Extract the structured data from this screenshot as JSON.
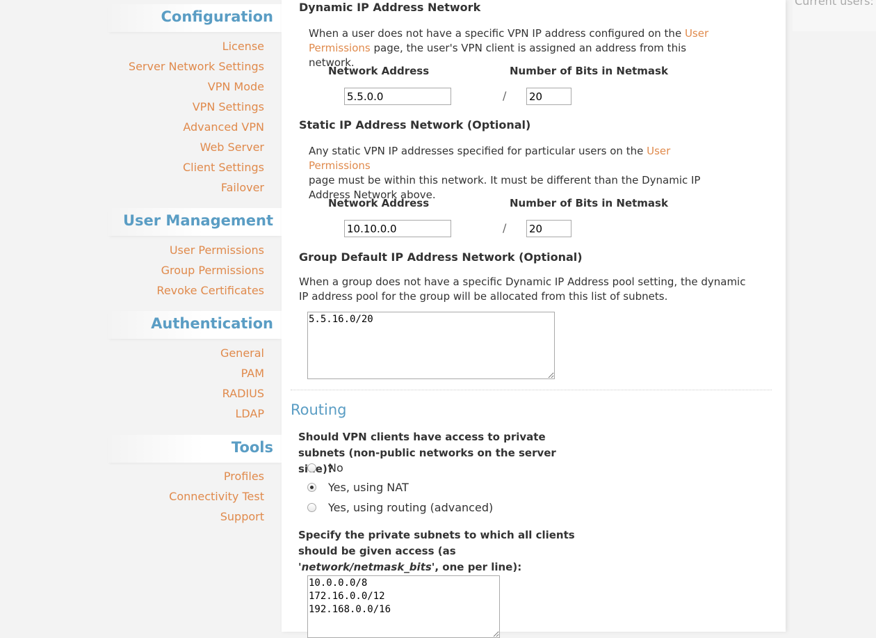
{
  "sidebar": {
    "sections": [
      {
        "title": "Configuration",
        "items": [
          "License",
          "Server Network Settings",
          "VPN Mode",
          "VPN Settings",
          "Advanced VPN",
          "Web Server",
          "Client Settings",
          "Failover"
        ]
      },
      {
        "title": "User Management",
        "items": [
          "User Permissions",
          "Group Permissions",
          "Revoke Certificates"
        ]
      },
      {
        "title": "Authentication",
        "items": [
          "General",
          "PAM",
          "RADIUS",
          "LDAP"
        ]
      },
      {
        "title": "Tools",
        "items": [
          "Profiles",
          "Connectivity Test",
          "Support"
        ]
      }
    ]
  },
  "header_right": {
    "text": "Current users:"
  },
  "dynamic": {
    "heading": "Dynamic IP Address Network",
    "desc_pre": "When a user does not have a specific VPN IP address configured on the ",
    "desc_link": "User Permissions",
    "desc_post": " page, the user's VPN client is assigned an address from this network.",
    "network_label": "Network Address",
    "bits_label": "Number of Bits in Netmask",
    "network_value": "5.5.0.0",
    "bits_value": "20",
    "slash": "/"
  },
  "static": {
    "heading": "Static IP Address Network (Optional)",
    "desc_pre": "Any static VPN IP addresses specified for particular users on the ",
    "desc_link": "User Permissions",
    "desc_post": " page must be within this network. It must be different than the Dynamic IP Address Network above.",
    "network_label": "Network Address",
    "bits_label": "Number of Bits in Netmask",
    "network_value": "10.10.0.0",
    "bits_value": "20",
    "slash": "/"
  },
  "group": {
    "heading": "Group Default IP Address Network (Optional)",
    "desc": "When a group does not have a specific Dynamic IP Address pool setting, the dynamic IP address pool for the group will be allocated from this list of subnets.",
    "textarea_value": "5.5.16.0/20"
  },
  "routing": {
    "title": "Routing",
    "question": "Should VPN clients have access to private subnets (non-public networks on the server side)?",
    "options": [
      {
        "label": "No",
        "checked": false
      },
      {
        "label": "Yes, using NAT",
        "checked": true
      },
      {
        "label": "Yes, using routing (advanced)",
        "checked": false
      }
    ],
    "subnets_pre": "Specify the private subnets to which all clients should be given access (as '",
    "subnets_em": "network/netmask_bits",
    "subnets_post": "', one per line):",
    "subnets_value": "10.0.0.0/8\n172.16.0.0/12\n192.168.0.0/16"
  },
  "colors": {
    "accent_blue": "#5a9dc4",
    "link_orange": "#e08a4c"
  }
}
